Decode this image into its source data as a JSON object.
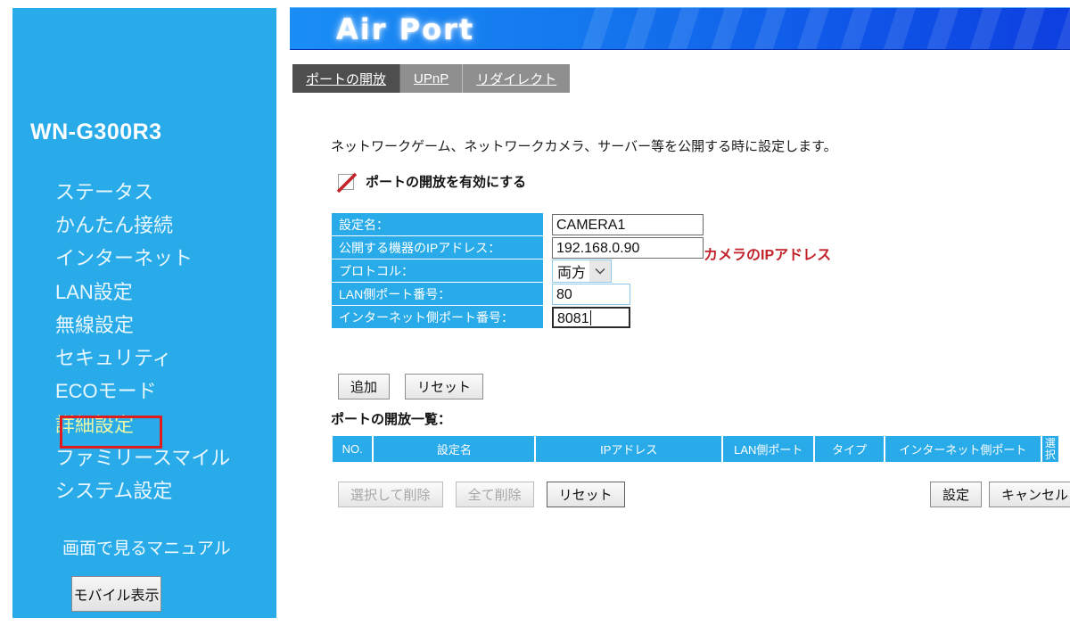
{
  "sidebar": {
    "device_title": "WN-G300R3",
    "items": [
      {
        "label": "ステータス",
        "highlighted": false
      },
      {
        "label": "かんたん接続",
        "highlighted": false
      },
      {
        "label": "インターネット",
        "highlighted": false
      },
      {
        "label": "LAN設定",
        "highlighted": false
      },
      {
        "label": "無線設定",
        "highlighted": false
      },
      {
        "label": "セキュリティ",
        "highlighted": false
      },
      {
        "label": "ECOモード",
        "highlighted": false
      },
      {
        "label": "詳細設定",
        "highlighted": true
      },
      {
        "label": "ファミリースマイル",
        "highlighted": false
      },
      {
        "label": "システム設定",
        "highlighted": false
      }
    ],
    "manual_link": "画面で見るマニュアル",
    "mobile_button": "モバイル表示",
    "bg_color": "#29abe9",
    "highlight_text_color": "#e9f5a8",
    "highlight_box_color": "#e01b1b"
  },
  "header": {
    "logo_text": "Air Port",
    "banner_color_start": "#1a8ef5",
    "banner_color_end": "#0d3fe0"
  },
  "tabs": [
    {
      "label": "ポートの開放",
      "active": true
    },
    {
      "label": "UPnP",
      "active": false
    },
    {
      "label": "リダイレクト",
      "active": false
    }
  ],
  "main": {
    "description": "ネットワークゲーム、ネットワークカメラ、サーバー等を公開する時に設定します。",
    "enable_label": "ポートの開放を有効にする",
    "enable_checked": false,
    "annotation_ip": "カメラのIPアドレス",
    "annotation_color": "#c2232a",
    "form_fields": [
      {
        "label": "設定名：",
        "value": "CAMERA1",
        "type": "text"
      },
      {
        "label": "公開する機器のIPアドレス：",
        "value": "192.168.0.90",
        "type": "text"
      },
      {
        "label": "プロトコル：",
        "value": "両方",
        "type": "select"
      },
      {
        "label": "LAN側ポート番号：",
        "value": "80",
        "type": "text"
      },
      {
        "label": "インターネット側ポート番号：",
        "value": "8081",
        "type": "text"
      }
    ],
    "form_actions": [
      {
        "label": "追加",
        "disabled": false
      },
      {
        "label": "リセット",
        "disabled": false
      }
    ],
    "list_title": "ポートの開放一覧：",
    "list_headers": [
      "NO.",
      "設定名",
      "IPアドレス",
      "LAN側ポート",
      "タイプ",
      "インターネット側ポート"
    ],
    "list_header_select": "選択",
    "list_rows": [],
    "list_actions_left": [
      {
        "label": "選択して削除",
        "disabled": true
      },
      {
        "label": "全て削除",
        "disabled": true
      },
      {
        "label": "リセット",
        "disabled": false
      }
    ],
    "list_actions_right": [
      {
        "label": "設定",
        "disabled": false
      },
      {
        "label": "キャンセル",
        "disabled": false
      }
    ]
  }
}
